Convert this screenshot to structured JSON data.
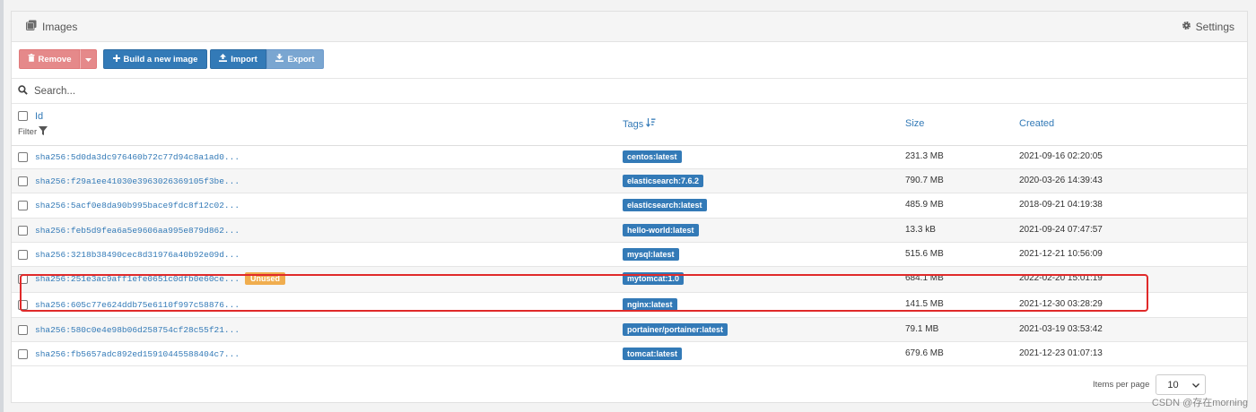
{
  "header": {
    "title": "Images",
    "settings_label": "Settings"
  },
  "toolbar": {
    "remove_label": "Remove",
    "build_label": "Build a new image",
    "import_label": "Import",
    "export_label": "Export"
  },
  "search": {
    "placeholder": "Search..."
  },
  "table": {
    "columns": {
      "id": "Id",
      "filter": "Filter",
      "tags": "Tags",
      "size": "Size",
      "created": "Created"
    },
    "rows": [
      {
        "id": "sha256:5d0da3dc976460b72c77d94c8a1ad0...",
        "tag": "centos:latest",
        "size": "231.3 MB",
        "created": "2021-09-16 02:20:05"
      },
      {
        "id": "sha256:f29a1ee41030e3963026369105f3be...",
        "tag": "elasticsearch:7.6.2",
        "size": "790.7 MB",
        "created": "2020-03-26 14:39:43"
      },
      {
        "id": "sha256:5acf0e8da90b995bace9fdc8f12c02...",
        "tag": "elasticsearch:latest",
        "size": "485.9 MB",
        "created": "2018-09-21 04:19:38"
      },
      {
        "id": "sha256:feb5d9fea6a5e9606aa995e879d862...",
        "tag": "hello-world:latest",
        "size": "13.3 kB",
        "created": "2021-09-24 07:47:57"
      },
      {
        "id": "sha256:3218b38490cec8d31976a40b92e09d...",
        "tag": "mysql:latest",
        "size": "515.6 MB",
        "created": "2021-12-21 10:56:09"
      },
      {
        "id": "sha256:251e3ac9aff1efe0651c0dfb0e60ce...",
        "badge": "Unused",
        "tag": "mytomcat:1.0",
        "size": "684.1 MB",
        "created": "2022-02-20 15:01:19"
      },
      {
        "id": "sha256:605c77e624ddb75e6110f997c58876...",
        "tag": "nginx:latest",
        "size": "141.5 MB",
        "created": "2021-12-30 03:28:29"
      },
      {
        "id": "sha256:580c0e4e98b06d258754cf28c55f21...",
        "tag": "portainer/portainer:latest",
        "size": "79.1 MB",
        "created": "2021-03-19 03:53:42"
      },
      {
        "id": "sha256:fb5657adc892ed15910445588404c7...",
        "tag": "tomcat:latest",
        "size": "679.6 MB",
        "created": "2021-12-23 01:07:13"
      }
    ]
  },
  "pagination": {
    "items_per_page_label": "Items per page",
    "items_per_page_value": "10"
  },
  "watermark": "CSDN @存在morning"
}
